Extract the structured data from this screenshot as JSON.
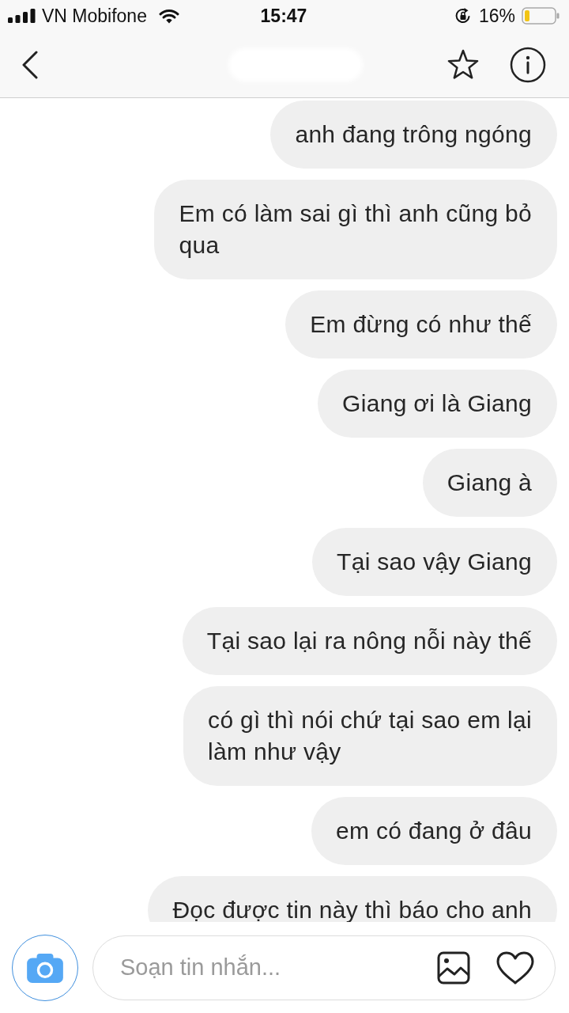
{
  "status_bar": {
    "carrier": "VN Mobifone",
    "time": "15:47",
    "battery": "16%"
  },
  "messages": [
    {
      "text": "anh đang trông ngóng"
    },
    {
      "text": "Em có làm sai gì thì anh cũng bỏ\nqua"
    },
    {
      "text": "Em đừng có như thế"
    },
    {
      "text": "Giang ơi là Giang"
    },
    {
      "text": "Giang à"
    },
    {
      "text": "Tại sao vậy Giang"
    },
    {
      "text": "Tại sao lại ra nông nỗi này thế"
    },
    {
      "text": "có gì thì nói chứ tại sao em lại\nlàm như vậy"
    },
    {
      "text": "em có đang ở đâu"
    },
    {
      "text": "Đọc được tin này thì báo cho anh"
    }
  ],
  "composer": {
    "placeholder": "Soạn tin nhắn..."
  }
}
